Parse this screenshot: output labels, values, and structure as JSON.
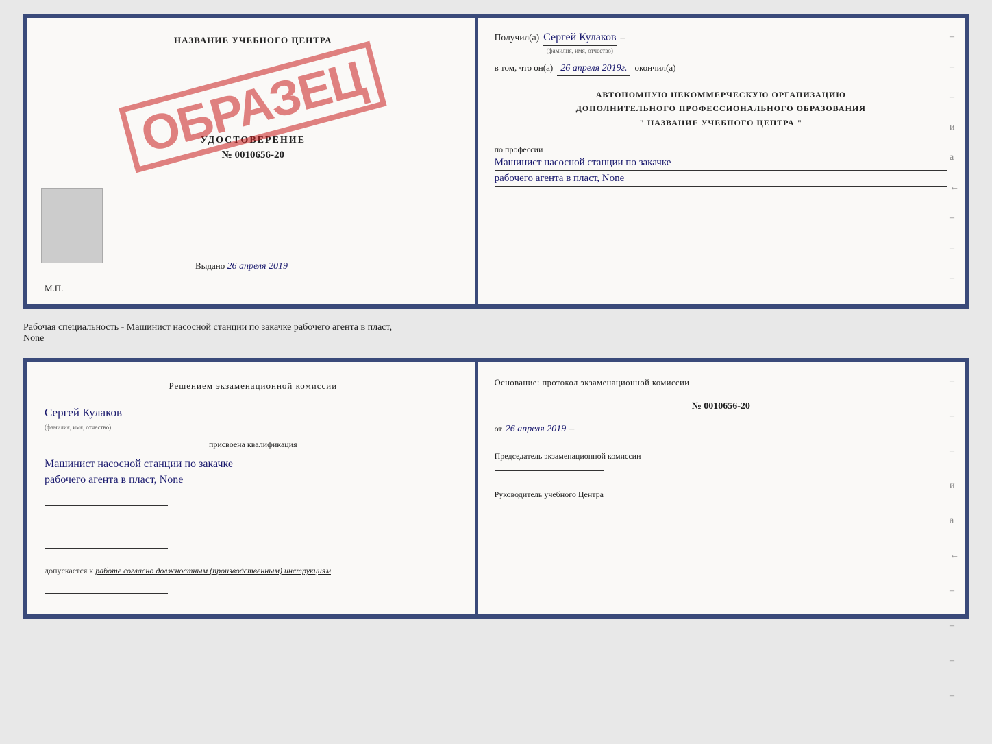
{
  "page": {
    "background_color": "#e8e8e8"
  },
  "top_left": {
    "title": "НАЗВАНИЕ УЧЕБНОГО ЦЕНТРА",
    "obrazec": "ОБРАЗЕЦ",
    "udostoverenie_label": "УДОСТОВЕРЕНИЕ",
    "number": "№ 0010656-20",
    "vydano_label": "Выдано",
    "vydano_date": "26 апреля 2019",
    "mp_label": "М.П."
  },
  "top_right": {
    "poluchil_label": "Получил(а)",
    "poluchil_name": "Сергей Кулаков",
    "poluchil_sublabel": "(фамилия, имя, отчество)",
    "vtom_label": "в том, что он(а)",
    "vtom_date": "26 апреля 2019г.",
    "okonchil_label": "окончил(а)",
    "center_line1": "АВТОНОМНУЮ НЕКОММЕРЧЕСКУЮ ОРГАНИЗАЦИЮ",
    "center_line2": "ДОПОЛНИТЕЛЬНОГО ПРОФЕССИОНАЛЬНОГО ОБРАЗОВАНИЯ",
    "center_line3": "\"  НАЗВАНИЕ УЧЕБНОГО ЦЕНТРА  \"",
    "profession_label": "по профессии",
    "profession_line1": "Машинист насосной станции по закачке",
    "profession_line2": "рабочего агента в пласт, None",
    "dashes": [
      "-",
      "-",
      "-",
      "и",
      "а",
      "←",
      "-",
      "-",
      "-"
    ]
  },
  "middle": {
    "text": "Рабочая специальность - Машинист насосной станции по закачке рабочего агента в пласт,",
    "text2": "None"
  },
  "bottom_left": {
    "resheniem": "Решением экзаменационной комиссии",
    "fio_name": "Сергей Кулаков",
    "fio_sublabel": "(фамилия, имя, отчество)",
    "prisvoena": "присвоена квалификация",
    "qual_line1": "Машинист насосной станции по закачке",
    "qual_line2": "рабочего агента в пласт, None",
    "dopuskaetsya_label": "допускается к",
    "dopuskaetsya_value": "работе согласно должностным (производственным) инструкциям"
  },
  "bottom_right": {
    "osnova_label": "Основание: протокол экзаменационной комиссии",
    "prot_number": "№ 0010656-20",
    "ot_label": "от",
    "prot_date": "26 апреля 2019",
    "predsedatel_label": "Председатель экзаменационной комиссии",
    "rukovod_label": "Руководитель учебного Центра",
    "dashes": [
      "-",
      "-",
      "-",
      "и",
      "а",
      "←",
      "-",
      "-",
      "-",
      "-"
    ]
  }
}
